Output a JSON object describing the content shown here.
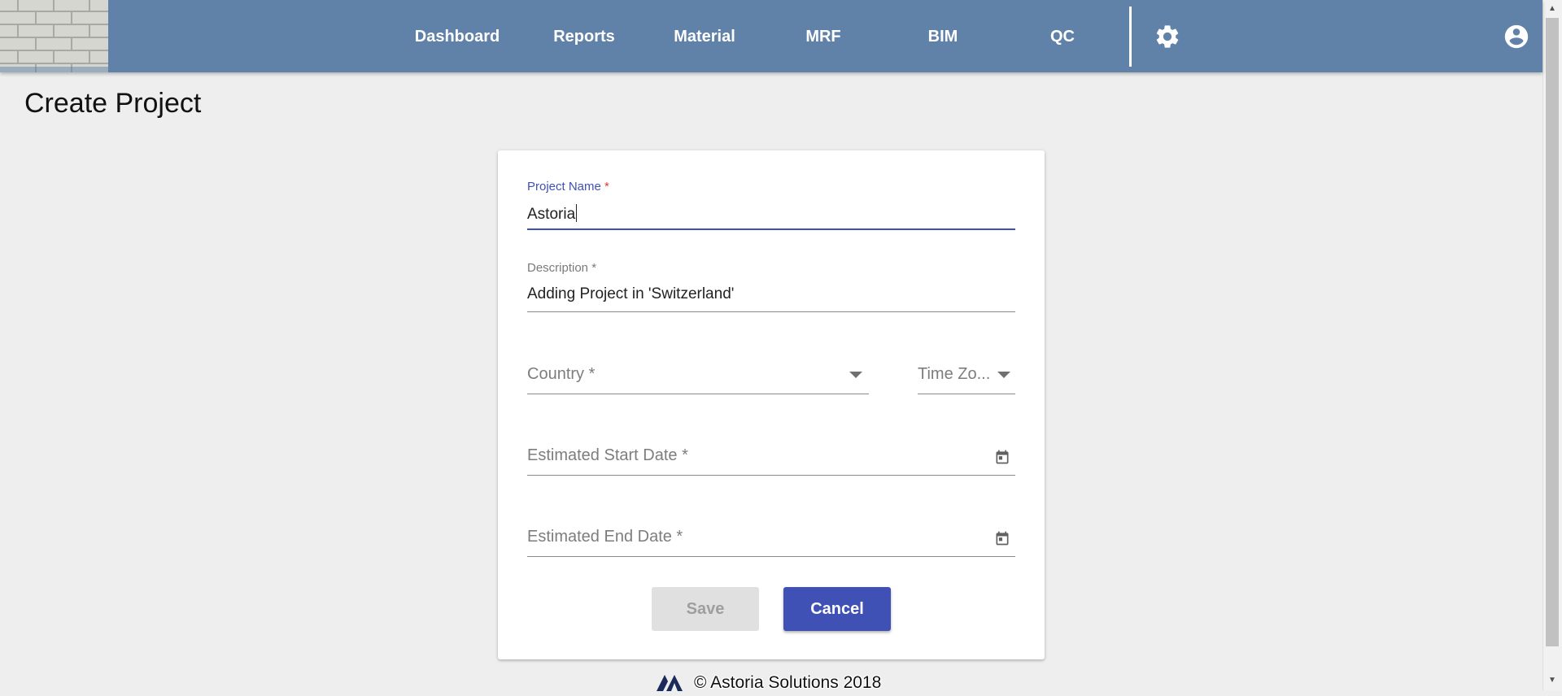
{
  "topbar": {
    "logo_icon": "brick-wall-image",
    "nav": [
      {
        "label": "Dashboard"
      },
      {
        "label": "Reports"
      },
      {
        "label": "Material"
      },
      {
        "label": "MRF"
      },
      {
        "label": "BIM"
      },
      {
        "label": "QC"
      }
    ],
    "settings_icon": "gear-icon",
    "account_icon": "account-circle-icon",
    "bar_color": "#6082a8"
  },
  "page": {
    "title": "Create Project"
  },
  "form": {
    "project_name": {
      "label": "Project Name",
      "required_mark": "*",
      "value": "Astoria"
    },
    "description": {
      "label": "Description *",
      "value": "Adding Project in 'Switzerland'"
    },
    "country": {
      "placeholder": "Country *",
      "icon": "chevron-down-icon"
    },
    "time_zone": {
      "placeholder": "Time Zo...",
      "icon": "chevron-down-icon"
    },
    "start_date": {
      "placeholder": "Estimated Start Date *",
      "icon": "calendar-icon"
    },
    "end_date": {
      "placeholder": "Estimated End Date *",
      "icon": "calendar-icon"
    },
    "save_label": "Save",
    "cancel_label": "Cancel",
    "accent_color": "#3f51b5"
  },
  "footer": {
    "logo_icon": "astoria-logo-icon",
    "text": "© Astoria Solutions 2018"
  }
}
